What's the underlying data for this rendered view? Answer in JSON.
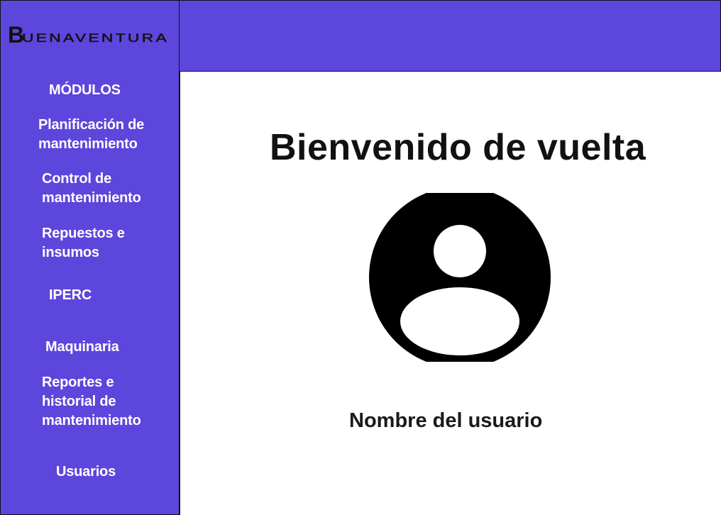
{
  "header": {
    "logo_initial": "B",
    "logo_text": "UENAVENTURA"
  },
  "sidebar": {
    "heading": "MÓDULOS",
    "items": [
      {
        "lines": [
          "Planificación de",
          "mantenimiento"
        ]
      },
      {
        "lines": [
          "Control de",
          "mantenimiento"
        ]
      },
      {
        "lines": [
          "Repuestos e",
          "insumos"
        ]
      },
      {
        "lines": [
          "IPERC"
        ]
      },
      {
        "lines": [
          "Maquinaria"
        ]
      },
      {
        "lines": [
          "Reportes e",
          "historial de",
          "mantenimiento"
        ]
      },
      {
        "lines": [
          "Usuarios"
        ]
      }
    ]
  },
  "main": {
    "title": "Bienvenido de vuelta",
    "avatar_icon": "user-circle-icon",
    "user_name": "Nombre del usuario"
  },
  "colors": {
    "brand_purple": "#5c46dc",
    "text_dark": "#111111",
    "white": "#ffffff"
  }
}
